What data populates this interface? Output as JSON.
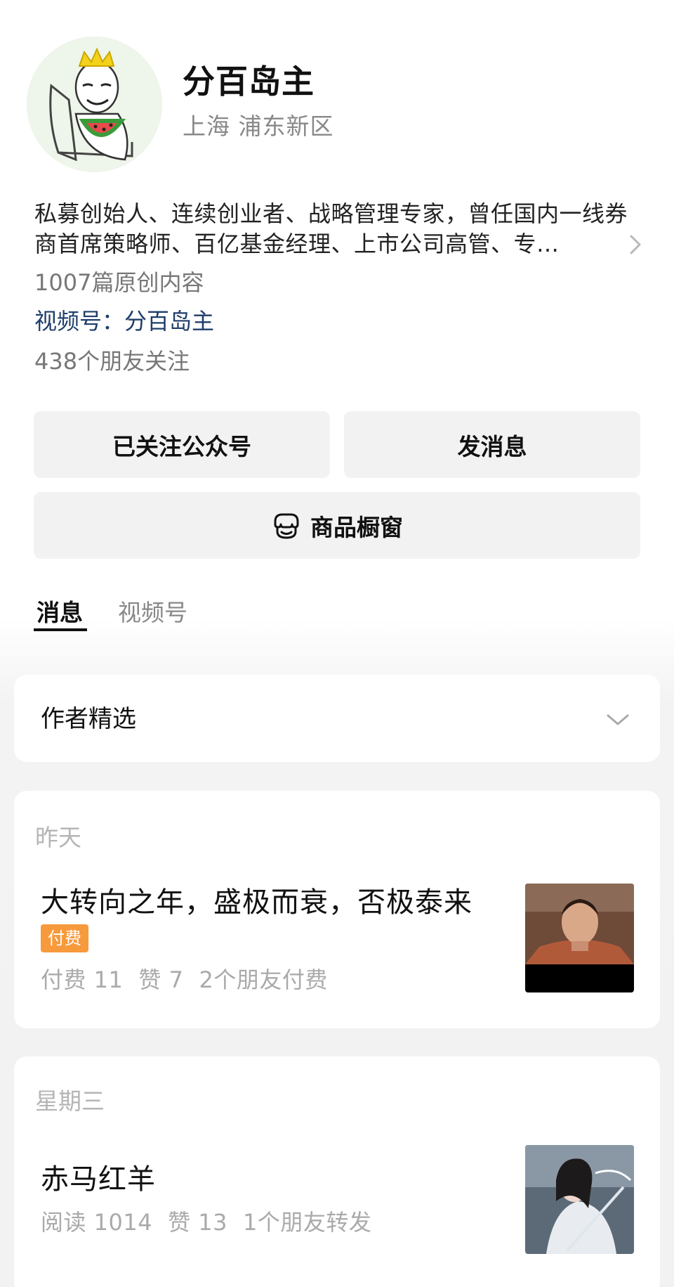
{
  "profile": {
    "name": "分百岛主",
    "location": "上海 浦东新区",
    "bio": "私募创始人、连续创业者、战略管理专家，曾任国内一线券商首席策略师、百亿基金经理、上市公司高管、专…",
    "original_count": "1007篇原创内容",
    "video_channel": "视频号：分百岛主",
    "friends_following": "438个朋友关注"
  },
  "actions": {
    "followed_label": "已关注公众号",
    "message_label": "发消息",
    "shop_label": "商品橱窗"
  },
  "tabs": [
    {
      "label": "消息",
      "active": true
    },
    {
      "label": "视频号",
      "active": false
    }
  ],
  "featured": {
    "label": "作者精选"
  },
  "articles": [
    {
      "day": "昨天",
      "title": "大转向之年，盛极而衰，否极泰来",
      "badge": "付费",
      "meta": [
        "付费 11",
        "赞 7",
        "2个朋友付费"
      ]
    },
    {
      "day": "星期三",
      "title": "赤马红羊",
      "meta": [
        "阅读 1014",
        "赞 13",
        "1个朋友转发"
      ]
    }
  ],
  "colors": {
    "link": "#1f3d6b",
    "badge": "#f79a3c",
    "button_bg": "#f2f2f2"
  },
  "icons": [
    "avatar-illustration",
    "chevron-right-icon",
    "shop-icon",
    "chevron-down-icon"
  ]
}
